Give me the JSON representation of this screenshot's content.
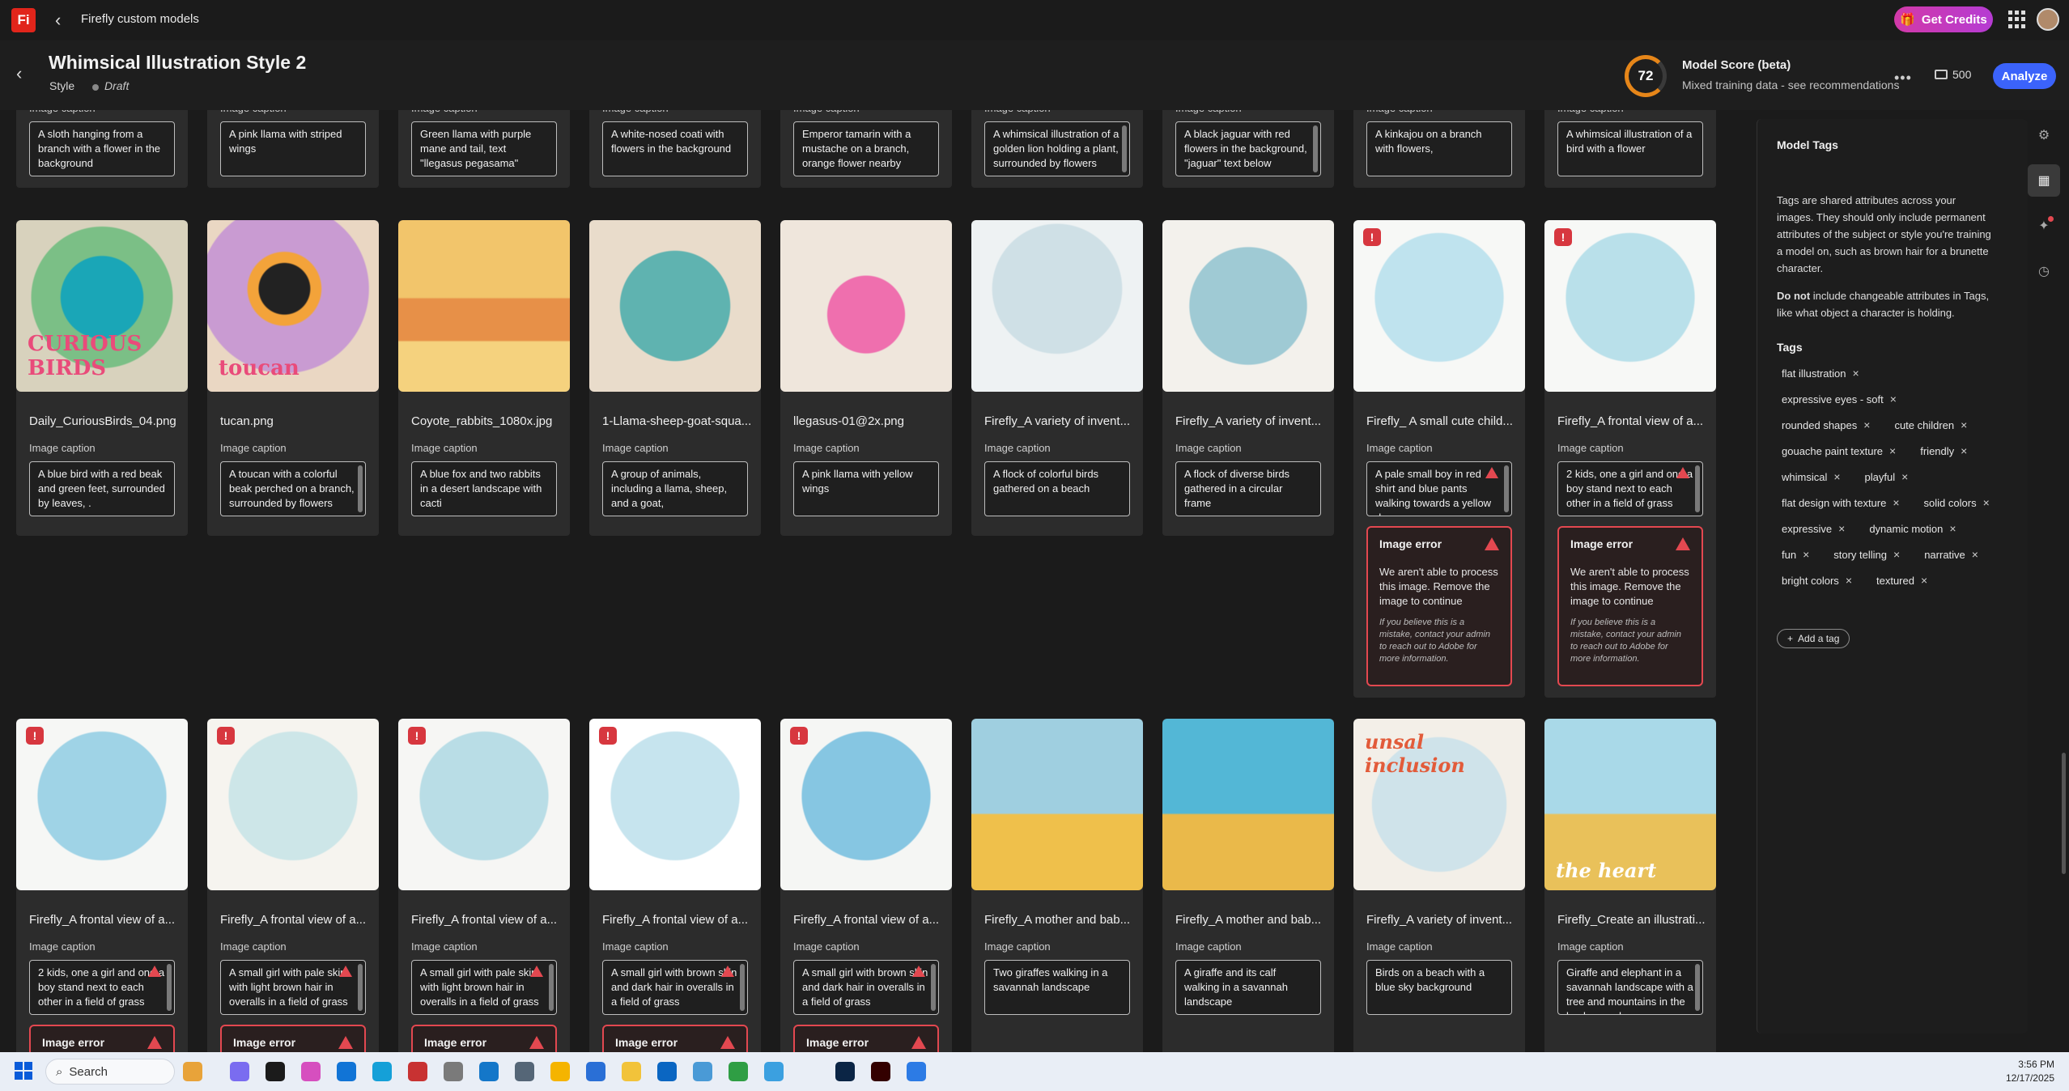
{
  "app": {
    "logo_text": "Fi",
    "title": "Firefly custom models",
    "credits_label": "Get Credits",
    "credits_color": "#c63ab9"
  },
  "header": {
    "model_title": "Whimsical Illustration Style 2",
    "model_type": "Style",
    "model_status": "Draft",
    "score": "72",
    "score_title": "Model Score (beta)",
    "score_subtitle": "Mixed training data - see recommendations",
    "image_count": "500",
    "analyze_label": "Analyze",
    "accent": "#3b63fb"
  },
  "row0": {
    "caption_label": "Image caption",
    "captions": [
      "A sloth hanging from a branch with a flower in the background",
      "A pink llama with striped wings",
      "Green llama with purple mane and tail, text \"llegasus pegasama\"",
      "A white-nosed coati with flowers in the background",
      "Emperor tamarin with a mustache on a branch, orange flower nearby",
      "A whimsical illustration of a golden lion holding a plant, surrounded by flowers",
      "A black jaguar with red flowers in the background, \"jaguar\" text below",
      "A kinkajou on a branch with flowers,",
      "A whimsical illustration of a bird with a flower"
    ]
  },
  "row1": [
    {
      "file": "Daily_CuriousBirds_04.png",
      "caption": "A blue bird with a red beak and green feet, surrounded by leaves, .",
      "img_text": "CURIOUS BIRDS"
    },
    {
      "file": "tucan.png",
      "caption": "A toucan with a colorful beak perched on a branch, surrounded by flowers",
      "img_text": "toucan"
    },
    {
      "file": "Coyote_rabbits_1080x.jpg",
      "caption": "A blue fox and two rabbits in a desert landscape with cacti"
    },
    {
      "file": "1-Llama-sheep-goat-squa...",
      "caption": "A group of animals, including a llama, sheep, and a goat,"
    },
    {
      "file": "llegasus-01@2x.png",
      "caption": "A pink llama with yellow wings"
    },
    {
      "file": "Firefly_A variety of invent...",
      "caption": "A flock of colorful birds gathered on a beach"
    },
    {
      "file": "Firefly_A variety of invent...",
      "caption": "A flock of diverse birds gathered in a circular frame"
    },
    {
      "file": "Firefly_ A small cute child...",
      "caption": "A pale small boy in red shirt and blue pants walking towards a yellow dog"
    },
    {
      "file": "Firefly_A frontal view of a...",
      "caption": "2 kids, one a girl and one a boy stand next to each other in a field of grass"
    }
  ],
  "error": {
    "title": "Image error",
    "message": "We aren't able to process this image. Remove the image to continue",
    "fine": "If you believe this is a mistake, contact your admin to reach out to Adobe for more information.",
    "color": "#e34850"
  },
  "row2": [
    {
      "file": "Firefly_A frontal view of a...",
      "caption": "2 kids, one a girl and one a boy stand next to each other in a field of grass"
    },
    {
      "file": "Firefly_A frontal view of a...",
      "caption": "A small girl with pale skin with light brown hair in overalls in a field of grass"
    },
    {
      "file": "Firefly_A frontal view of a...",
      "caption": "A small girl with pale skin with light brown hair in overalls in a field of grass"
    },
    {
      "file": "Firefly_A frontal view of a...",
      "caption": "A small girl with brown skin and dark hair in overalls in a field of grass"
    },
    {
      "file": "Firefly_A frontal view of a...",
      "caption": "A small girl with brown skin and dark hair in overalls in a field of grass"
    },
    {
      "file": "Firefly_A mother and bab...",
      "caption": "Two giraffes walking in a savannah landscape"
    },
    {
      "file": "Firefly_A mother and bab...",
      "caption": "A giraffe and its calf walking in a savannah landscape"
    },
    {
      "file": "Firefly_A variety of invent...",
      "caption": "Birds on a beach with a blue sky background",
      "img_text": "unsal inclusion"
    },
    {
      "file": "Firefly_Create an illustrati...",
      "caption": "Giraffe and elephant in a savannah landscape with a tree and mountains in the background",
      "img_text": "the heart"
    }
  ],
  "panel": {
    "title": "Model Tags",
    "description": "Tags are shared attributes across your images. They should only include permanent attributes of the subject or style you're training a model on, such as brown hair for a brunette character.",
    "do_not_bold": "Do not",
    "do_not_rest": "include changeable attributes in Tags, like what object a character is holding.",
    "tags_label": "Tags",
    "tags": [
      "flat illustration",
      "expressive eyes - soft",
      "rounded shapes",
      "cute children",
      "gouache paint texture",
      "friendly",
      "whimsical",
      "playful",
      "flat design with texture",
      "solid colors",
      "expressive",
      "dynamic motion",
      "fun",
      "story telling",
      "narrative",
      "bright colors",
      "textured"
    ],
    "add_tag_label": "Add a tag"
  },
  "taskbar": {
    "search_placeholder": "Search",
    "time": "3:56 PM",
    "date": "12/17/2025"
  }
}
